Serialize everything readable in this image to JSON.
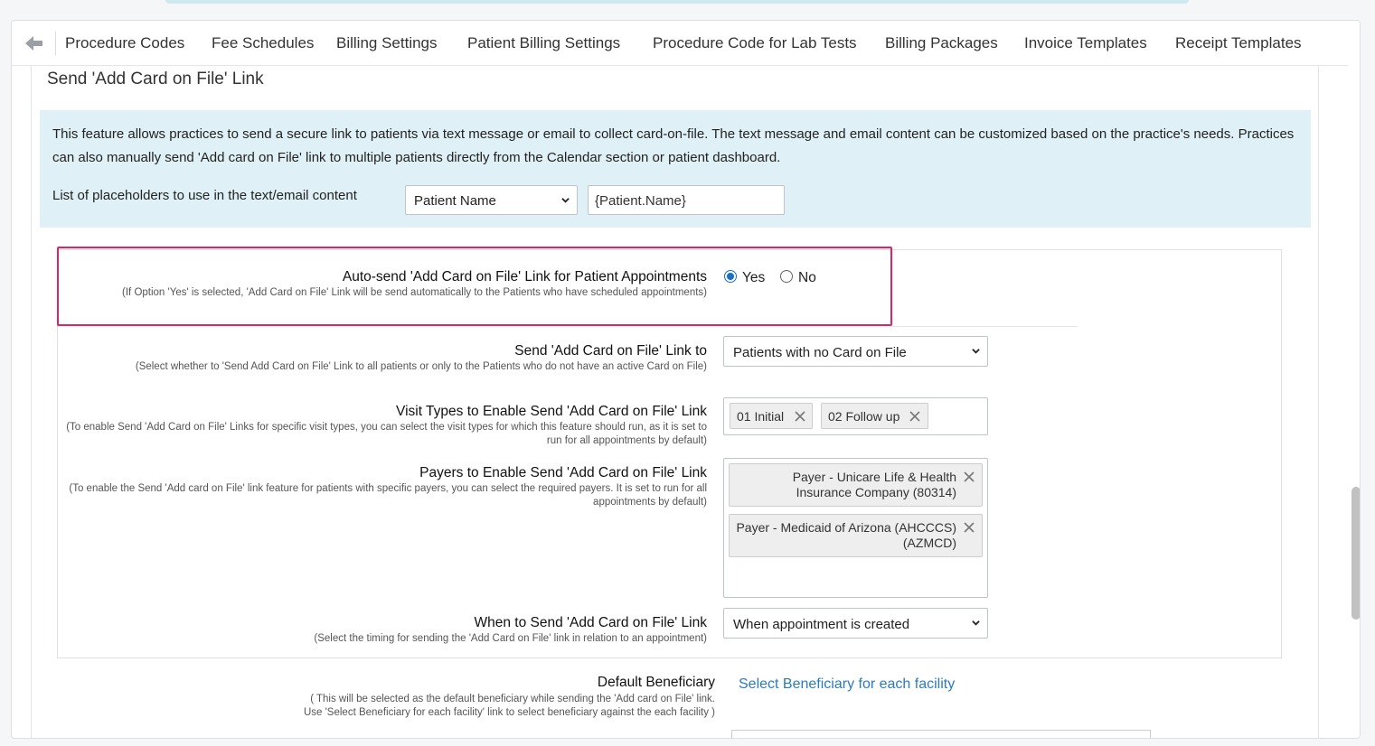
{
  "tabs": [
    "Procedure Codes",
    "Fee Schedules",
    "Billing Settings",
    "Patient Billing Settings",
    "Procedure Code for Lab Tests",
    "Billing Packages",
    "Invoice Templates",
    "Receipt Templates"
  ],
  "section_title": "Send 'Add Card on File' Link",
  "info": {
    "text": "This feature allows practices to send a secure link to patients via text message or email to collect card-on-file. The text message and email content can be customized based on the practice's needs. Practices can also manually send 'Add card on File' link to multiple patients directly from the Calendar section or patient dashboard.",
    "placeholder_label": "List of placeholders to use in the text/email content",
    "placeholder_select": "Patient Name",
    "placeholder_value": "{Patient.Name}"
  },
  "auto_send": {
    "label": "Auto-send 'Add Card on File' Link for Patient Appointments",
    "hint": "(If Option 'Yes' is selected, 'Add Card on File' Link will be send automatically to the Patients who have scheduled appointments)",
    "yes": "Yes",
    "no": "No",
    "selected": "Yes"
  },
  "send_to": {
    "label": "Send 'Add Card on File' Link to",
    "hint": "(Select whether to 'Send Add Card on File' Link to all patients or only to the Patients who do not have an active Card on File)",
    "value": "Patients with no Card on File"
  },
  "visit_types": {
    "label": "Visit Types to Enable Send 'Add Card on File' Link",
    "hint": "(To enable Send 'Add Card on File' Links for specific visit types, you can select the visit types for which this feature should run, as it is set to run for all appointments by default)",
    "chips": [
      "01 Initial",
      "02 Follow up"
    ]
  },
  "payers": {
    "label": "Payers to Enable Send 'Add Card on File' Link",
    "hint": "(To enable the Send 'Add card on File' link feature for patients with specific payers, you can select the required payers. It is set to run for all appointments by default)",
    "chips": [
      {
        "line1": "Payer - Unicare Life & Health",
        "line2": "Insurance Company (80314)"
      },
      {
        "line1": "Payer - Medicaid of Arizona (AHCCCS)",
        "line2": "(AZMCD)"
      }
    ]
  },
  "timing": {
    "label": "When to Send 'Add Card on File' Link",
    "hint": "(Select the timing for sending the 'Add Card on File' link in relation to an appointment)",
    "value": "When appointment is created"
  },
  "beneficiary": {
    "label": "Default Beneficiary",
    "hint1": "( This will be selected as the default beneficiary while sending the 'Add card on File' link.",
    "hint2": "Use 'Select Beneficiary for each facility' link to select beneficiary against the each facility )",
    "link": "Select Beneficiary for each facility"
  },
  "colors": {
    "accent": "#1b6fc7",
    "highlight": "#e0245e",
    "info_bg": "#dff1f7",
    "link": "#2b7bbf"
  }
}
